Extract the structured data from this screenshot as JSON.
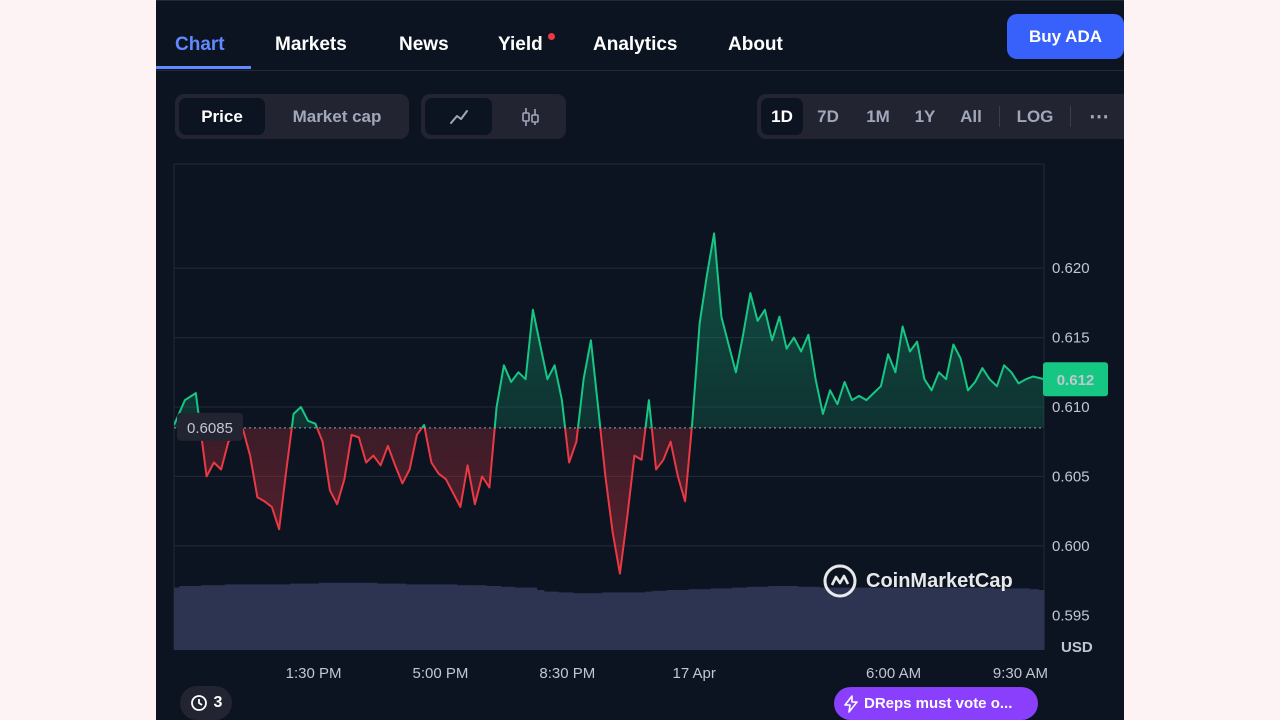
{
  "nav": {
    "tabs": [
      {
        "label": "Chart",
        "active": true,
        "dot": false
      },
      {
        "label": "Markets",
        "active": false,
        "dot": false
      },
      {
        "label": "News",
        "active": false,
        "dot": false
      },
      {
        "label": "Yield",
        "active": false,
        "dot": true
      },
      {
        "label": "Analytics",
        "active": false,
        "dot": false
      },
      {
        "label": "About",
        "active": false,
        "dot": false
      }
    ],
    "buy_label": "Buy ADA"
  },
  "toolbar": {
    "metric_toggle": [
      "Price",
      "Market cap"
    ],
    "metric_selected": "Price",
    "chart_style_icons": [
      "line-chart-icon",
      "candlestick-icon"
    ],
    "ranges": [
      "1D",
      "7D",
      "1M",
      "1Y",
      "All"
    ],
    "range_selected": "1D",
    "scale_label": "LOG",
    "more_icon": "more-dots-icon"
  },
  "chart_data": {
    "type": "area",
    "baseline": 0.6085,
    "baseline_label": "0.6085",
    "current_price": 0.612,
    "current_price_label": "0.612",
    "currency_label": "USD",
    "ylim": [
      0.5925,
      0.6275
    ],
    "y_ticks": [
      0.595,
      0.6,
      0.605,
      0.61,
      0.615,
      0.62
    ],
    "y_tick_labels": [
      "0.595",
      "0.600",
      "0.605",
      "0.610",
      "0.615",
      "0.620"
    ],
    "x_tick_labels": [
      "1:30 PM",
      "5:00 PM",
      "8:30 PM",
      "17 Apr",
      "6:00 AM",
      "9:30 AM"
    ],
    "x_tick_hours": [
      3.85,
      7.35,
      10.85,
      14.35,
      19.85,
      23.35
    ],
    "x_range_hours": [
      0,
      24
    ],
    "series": [
      {
        "x_hours": [
          0,
          0.3,
          0.6,
          0.9,
          1.1,
          1.3,
          1.5,
          1.7,
          1.9,
          2.1,
          2.3,
          2.5,
          2.7,
          2.9,
          3.1,
          3.3,
          3.5,
          3.7,
          3.9,
          4.1,
          4.3,
          4.5,
          4.7,
          4.9,
          5.1,
          5.3,
          5.5,
          5.7,
          5.9,
          6.1,
          6.3,
          6.5,
          6.7,
          6.9,
          7.1,
          7.3,
          7.5,
          7.7,
          7.9,
          8.1,
          8.3,
          8.5,
          8.7,
          8.9,
          9.1,
          9.3,
          9.5,
          9.7,
          9.9,
          10.1,
          10.3,
          10.5,
          10.7,
          10.9,
          11.1,
          11.3,
          11.5,
          11.7,
          11.9,
          12.1,
          12.3,
          12.5,
          12.7,
          12.9,
          13.1,
          13.3,
          13.5,
          13.7,
          13.9,
          14.1,
          14.3,
          14.5,
          14.7,
          14.9,
          15.1,
          15.3,
          15.5,
          15.7,
          15.9,
          16.1,
          16.3,
          16.5,
          16.7,
          16.9,
          17.1,
          17.3,
          17.5,
          17.7,
          17.9,
          18.1,
          18.3,
          18.5,
          18.7,
          18.9,
          19.1,
          19.3,
          19.5,
          19.7,
          19.9,
          20.1,
          20.3,
          20.5,
          20.7,
          20.9,
          21.1,
          21.3,
          21.5,
          21.7,
          21.9,
          22.1,
          22.3,
          22.5,
          22.7,
          22.9,
          23.1,
          23.3,
          23.5,
          23.7,
          24.0
        ],
        "price": [
          0.6087,
          0.6105,
          0.611,
          0.605,
          0.606,
          0.6055,
          0.6075,
          0.608,
          0.6084,
          0.6065,
          0.6035,
          0.6032,
          0.6028,
          0.6012,
          0.6055,
          0.6095,
          0.61,
          0.609,
          0.6088,
          0.6075,
          0.604,
          0.603,
          0.6048,
          0.608,
          0.6078,
          0.606,
          0.6065,
          0.6058,
          0.6072,
          0.6058,
          0.6045,
          0.6055,
          0.608,
          0.6087,
          0.606,
          0.6052,
          0.6048,
          0.6038,
          0.6028,
          0.6058,
          0.603,
          0.605,
          0.6042,
          0.61,
          0.613,
          0.6118,
          0.6125,
          0.612,
          0.617,
          0.6145,
          0.612,
          0.613,
          0.6105,
          0.606,
          0.6075,
          0.612,
          0.6148,
          0.61,
          0.605,
          0.601,
          0.598,
          0.602,
          0.6065,
          0.6062,
          0.6105,
          0.6055,
          0.6062,
          0.6075,
          0.605,
          0.6032,
          0.609,
          0.616,
          0.6195,
          0.6225,
          0.6165,
          0.6145,
          0.6125,
          0.6152,
          0.6182,
          0.6162,
          0.617,
          0.6148,
          0.6165,
          0.6142,
          0.615,
          0.614,
          0.6152,
          0.612,
          0.6095,
          0.6112,
          0.6102,
          0.6118,
          0.6105,
          0.6108,
          0.6105,
          0.611,
          0.6115,
          0.6138,
          0.6125,
          0.6158,
          0.614,
          0.6147,
          0.612,
          0.6112,
          0.6125,
          0.612,
          0.6145,
          0.6135,
          0.6112,
          0.6118,
          0.6128,
          0.612,
          0.6115,
          0.613,
          0.6125,
          0.6117,
          0.612,
          0.6122,
          0.612
        ],
        "volume": [
          0.78,
          0.8,
          0.8,
          0.81,
          0.81,
          0.81,
          0.82,
          0.82,
          0.82,
          0.82,
          0.82,
          0.82,
          0.82,
          0.82,
          0.82,
          0.83,
          0.83,
          0.83,
          0.83,
          0.84,
          0.84,
          0.84,
          0.84,
          0.84,
          0.84,
          0.84,
          0.84,
          0.83,
          0.83,
          0.83,
          0.83,
          0.82,
          0.82,
          0.82,
          0.82,
          0.82,
          0.82,
          0.82,
          0.81,
          0.81,
          0.81,
          0.81,
          0.8,
          0.8,
          0.79,
          0.79,
          0.78,
          0.78,
          0.78,
          0.75,
          0.73,
          0.73,
          0.72,
          0.72,
          0.71,
          0.71,
          0.71,
          0.71,
          0.72,
          0.72,
          0.72,
          0.72,
          0.72,
          0.72,
          0.73,
          0.74,
          0.74,
          0.75,
          0.75,
          0.75,
          0.76,
          0.76,
          0.76,
          0.77,
          0.77,
          0.77,
          0.78,
          0.78,
          0.79,
          0.79,
          0.79,
          0.8,
          0.8,
          0.8,
          0.8,
          0.79,
          0.79,
          0.79,
          0.78,
          0.78,
          0.78,
          0.78,
          0.78,
          0.78,
          0.78,
          0.78,
          0.78,
          0.78,
          0.78,
          0.78,
          0.78,
          0.78,
          0.78,
          0.78,
          0.78,
          0.78,
          0.78,
          0.78,
          0.78,
          0.78,
          0.78,
          0.78,
          0.77,
          0.77,
          0.77,
          0.77,
          0.77,
          0.76,
          0.75
        ]
      }
    ],
    "colors": {
      "up": "#16c784",
      "down": "#ea3943",
      "volume": "#2c3452",
      "grid": "#222a38"
    },
    "watermark": "CoinMarketCap"
  },
  "footer": {
    "history_count": "3",
    "announcement": "DReps must vote o..."
  }
}
